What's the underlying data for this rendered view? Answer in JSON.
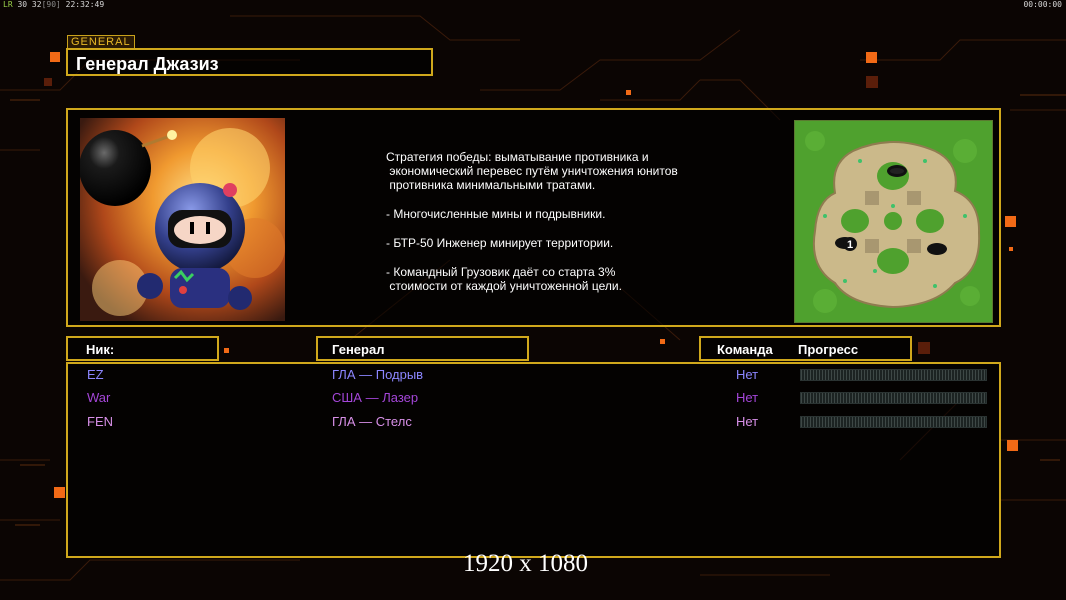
{
  "hud": {
    "fps_label": "LR",
    "fps_values": "30 32",
    "bracket": "[90]",
    "clock": "22:32:49",
    "timer": "00:00:00"
  },
  "header": {
    "tag": "GENERAL",
    "title": "Генерал Джазиз"
  },
  "description": [
    "Стратегия победы: выматывание противника и\n экономический перевес путём уничтожения юнитов\n противника минимальными тратами.",
    "- Многочисленные мины и подрывники.",
    "- БТР-50 Инженер минирует территории.",
    "- Командный Грузовик даёт со старта 3%\n стоимости от каждой уничтоженной цели."
  ],
  "minimap": {
    "marker": "1"
  },
  "columns": {
    "nick": "Ник:",
    "general": "Генерал",
    "team": "Команда",
    "progress": "Прогресс"
  },
  "players": [
    {
      "nick": "EZ",
      "general": "ГЛА — Подрыв",
      "team": "Нет",
      "color": "#8c86ff",
      "progress": 0
    },
    {
      "nick": "War",
      "general": "США — Лазер",
      "team": "Нет",
      "color": "#a446d8",
      "progress": 0
    },
    {
      "nick": "FEN",
      "general": "ГЛА — Стелс",
      "team": "Нет",
      "color": "#d890e8",
      "progress": 0
    }
  ],
  "resolution": "1920 x 1080"
}
